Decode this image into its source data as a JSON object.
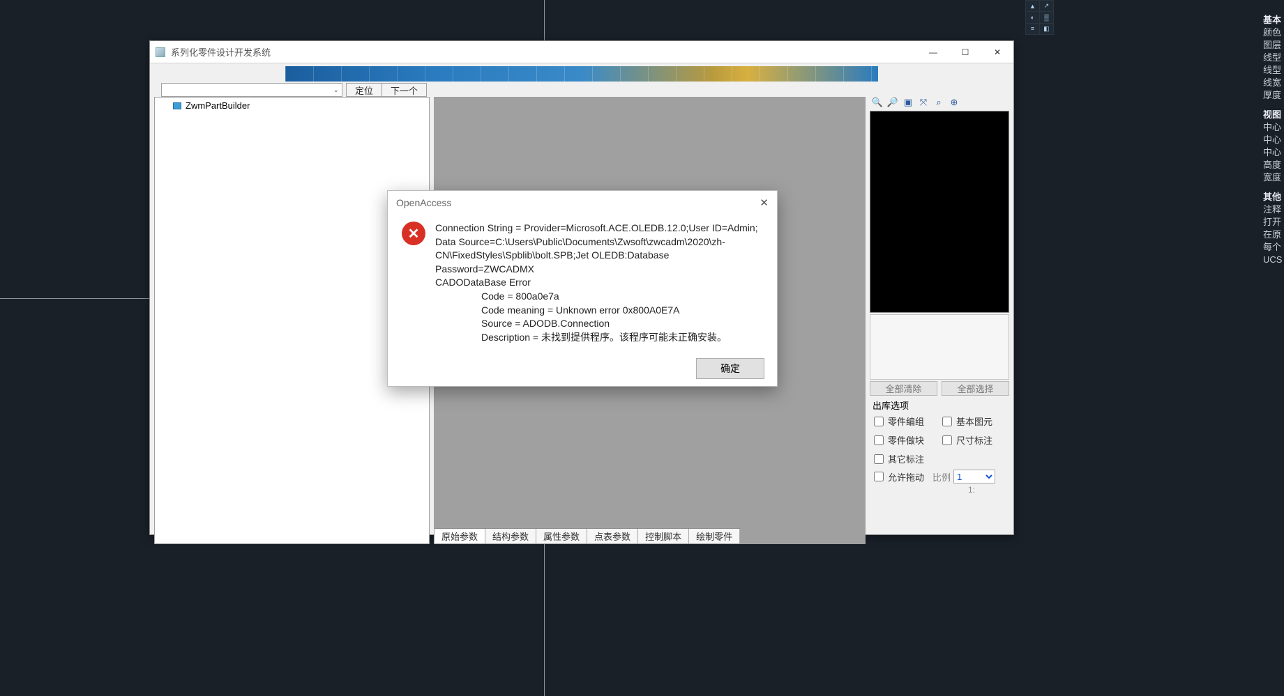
{
  "main_window": {
    "title": "系列化零件设计开发系统",
    "toolbar": {
      "locate": "定位",
      "next": "下一个"
    },
    "tree": {
      "root": "ZwmPartBuilder"
    },
    "center_tabs": [
      "原始参数",
      "结构参数",
      "属性参数",
      "点表参数",
      "控制脚本",
      "绘制零件"
    ],
    "right_panel": {
      "clear_all": "全部清除",
      "select_all": "全部选择",
      "out_label": "出库选项",
      "checks": [
        "零件编组",
        "基本图元",
        "零件做块",
        "尺寸标注",
        "其它标注",
        "允许拖动"
      ],
      "ratio_label": "比例",
      "ratio_value": "1",
      "ratio_display": "1:"
    }
  },
  "modal": {
    "title": "OpenAccess",
    "lines_main": "Connection String = Provider=Microsoft.ACE.OLEDB.12.0;User ID=Admin; Data Source=C:\\Users\\Public\\Documents\\Zwsoft\\zwcadm\\2020\\zh-CN\\FixedStyles\\Spblib\\bolt.SPB;Jet OLEDB:Database Password=ZWCADMX\nCADODataBase Error",
    "lines_indent": "Code = 800a0e7a\nCode meaning = Unknown error 0x800A0E7A\nSource = ADODB.Connection\nDescription = 未找到提供程序。该程序可能未正确安装。",
    "ok": "确定"
  },
  "side_panel": {
    "group1_header": "基本",
    "group1": [
      "颜色",
      "图层",
      "线型",
      "线型",
      "线宽",
      "厚度"
    ],
    "group2_header": "视图",
    "group2": [
      "中心",
      "中心",
      "中心",
      "高度",
      "宽度"
    ],
    "group3_header": "其他",
    "group3": [
      "注释",
      "打开",
      "在原",
      "每个",
      "UCS"
    ]
  }
}
